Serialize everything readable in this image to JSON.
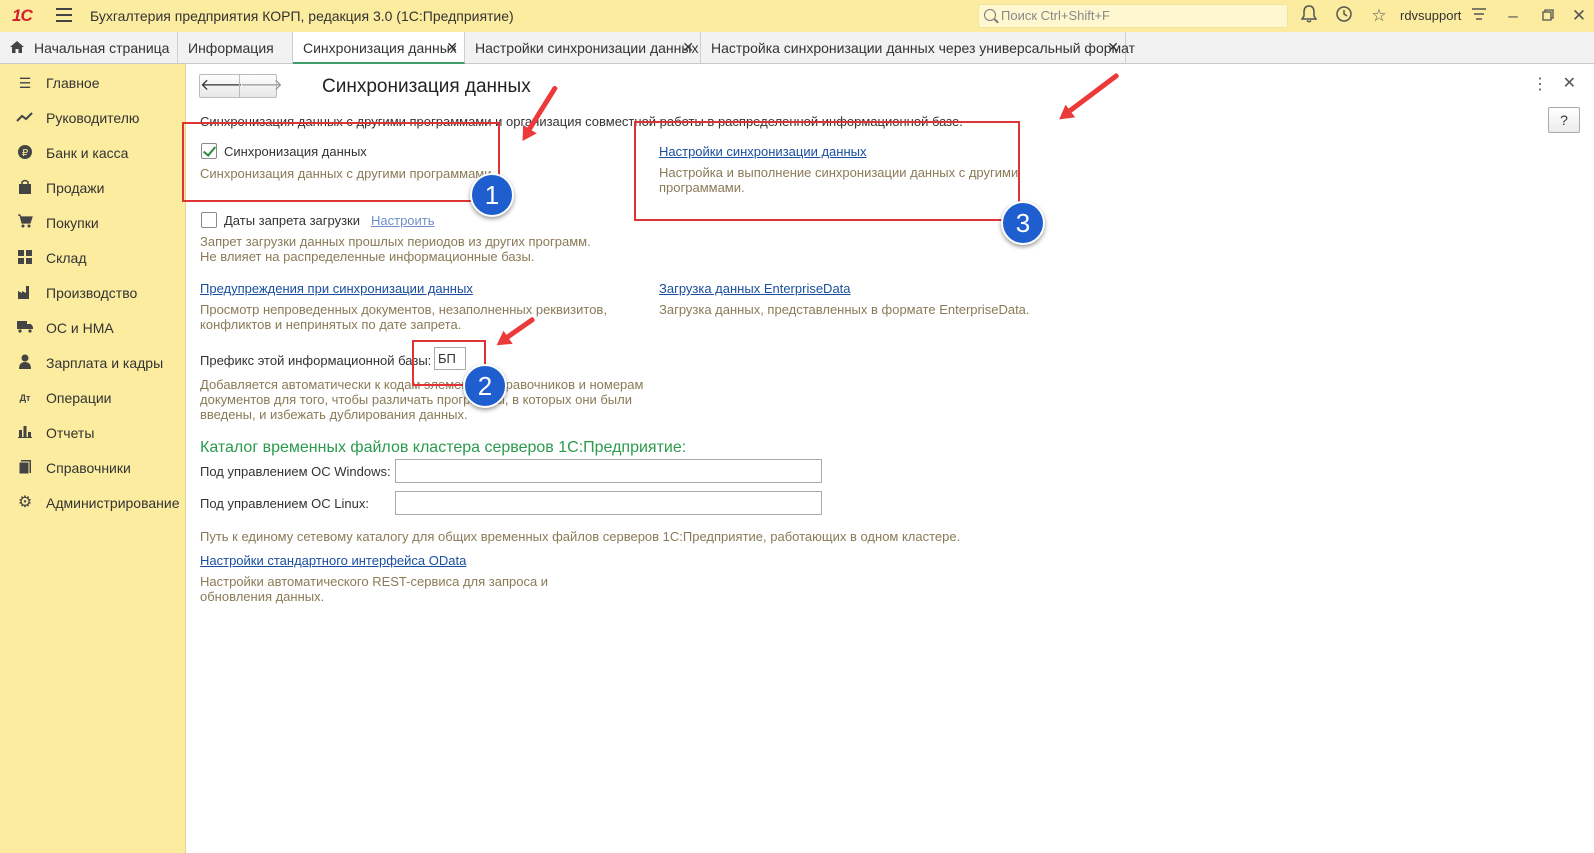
{
  "titlebar": {
    "logo": "1С",
    "app_title": "Бухгалтерия предприятия КОРП, редакция 3.0  (1С:Предприятие)",
    "search_placeholder": "Поиск Ctrl+Shift+F",
    "user": "rdvsupport"
  },
  "tabs": [
    {
      "label": "Начальная страница"
    },
    {
      "label": "Информация"
    },
    {
      "label": "Синхронизация данных"
    },
    {
      "label": "Настройки синхронизации данных"
    },
    {
      "label": "Настройка синхронизации данных через универсальный формат"
    }
  ],
  "sidebar": {
    "items": [
      {
        "label": "Главное",
        "icon": "menu-lines-icon"
      },
      {
        "label": "Руководителю",
        "icon": "trend-icon"
      },
      {
        "label": "Банк и касса",
        "icon": "ruble-coin-icon"
      },
      {
        "label": "Продажи",
        "icon": "shopping-bag-icon"
      },
      {
        "label": "Покупки",
        "icon": "cart-icon"
      },
      {
        "label": "Склад",
        "icon": "warehouse-grid-icon"
      },
      {
        "label": "Производство",
        "icon": "factory-icon"
      },
      {
        "label": "ОС и НМА",
        "icon": "truck-icon"
      },
      {
        "label": "Зарплата и кадры",
        "icon": "person-icon"
      },
      {
        "label": "Операции",
        "icon": "debit-credit-icon"
      },
      {
        "label": "Отчеты",
        "icon": "bar-chart-icon"
      },
      {
        "label": "Справочники",
        "icon": "book-icon"
      },
      {
        "label": "Администрирование",
        "icon": "gear-icon"
      }
    ]
  },
  "main": {
    "title": "Синхронизация данных",
    "intro": "Синхронизация данных с другими программами и организация совместной работы в распределенной информационной базе.",
    "sync_checkbox": {
      "label": "Синхронизация данных",
      "checked": true,
      "desc": "Синхронизация данных с другими программами"
    },
    "ban_dates": {
      "label": "Даты запрета загрузки",
      "link": "Настроить",
      "checked": false,
      "desc1": "Запрет загрузки данных прошлых периодов из других программ.",
      "desc2": "Не влияет на распределенные информационные базы."
    },
    "warnings": {
      "link": "Предупреждения при синхронизации данных",
      "desc1": "Просмотр непроведенных документов, незаполненных реквизитов,",
      "desc2": "конфликтов и непринятых по дате запрета."
    },
    "prefix": {
      "label": "Префикс этой информационной базы:",
      "value": "БП",
      "desc1": "Добавляется автоматически к кодам элементов справочников и номерам",
      "desc2": "документов для того, чтобы различать программы, в которых они были",
      "desc3": "введены, и избежать дублирования данных."
    },
    "sync_settings": {
      "link": "Настройки синхронизации данных",
      "desc1": "Настройка и выполнение синхронизации данных с другими",
      "desc2": "программами."
    },
    "enterprise_data": {
      "link": "Загрузка данных EnterpriseData",
      "desc": "Загрузка данных, представленных в формате EnterpriseData."
    },
    "cluster": {
      "title": "Каталог временных файлов кластера серверов 1С:Предприятие:",
      "windows_label": "Под управлением ОС Windows:",
      "windows_value": "",
      "linux_label": "Под управлением ОС Linux:",
      "linux_value": "",
      "desc": "Путь к единому сетевому каталогу для общих временных файлов серверов 1С:Предприятие, работающих в одном кластере."
    },
    "odata": {
      "link": "Настройки стандартного интерфейса OData",
      "desc1": "Настройки автоматического REST-сервиса для запроса и",
      "desc2": "обновления данных."
    },
    "help": "?"
  },
  "annotations": {
    "markers": [
      "1",
      "2",
      "3"
    ],
    "color": "#e03434",
    "marker_color": "#1f5ecf"
  }
}
